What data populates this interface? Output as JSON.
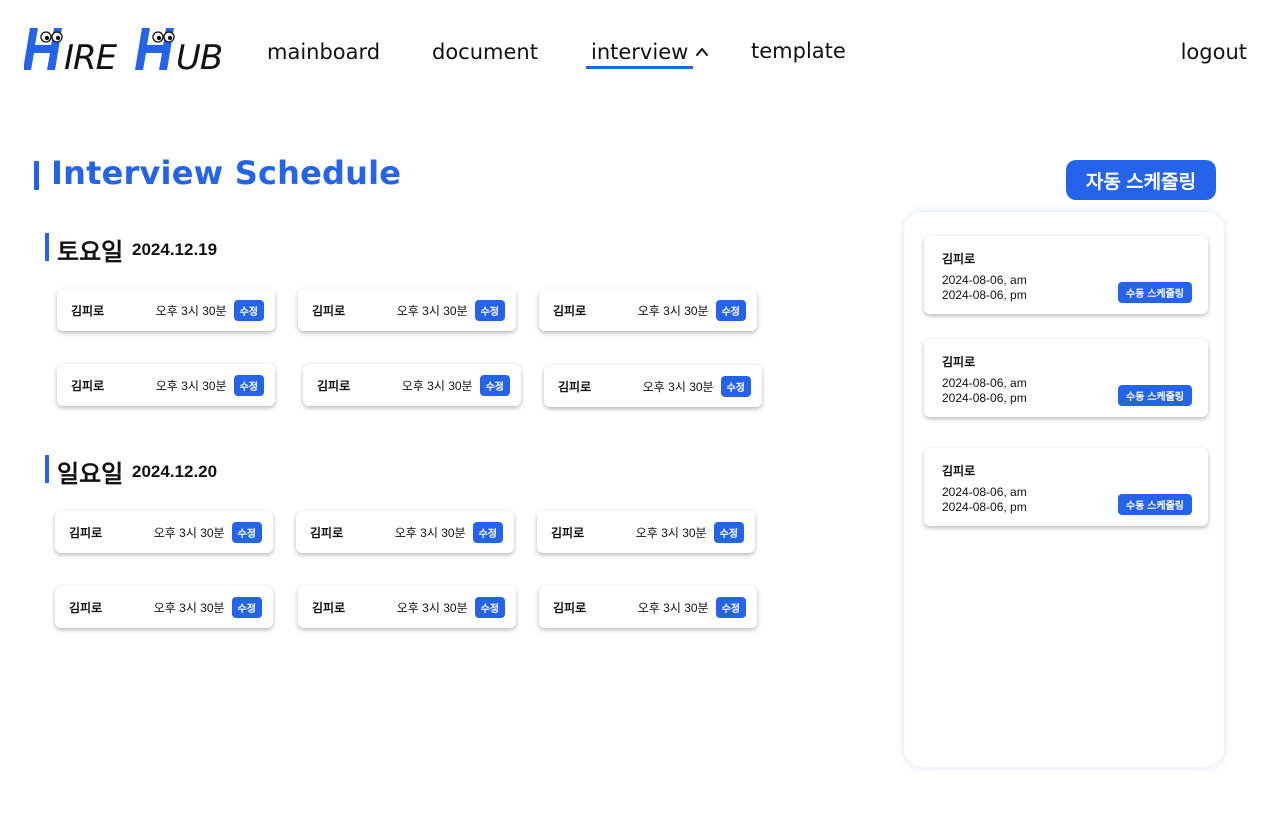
{
  "brand": {
    "logo_text": "HIRE HUB",
    "accent_color": "#2563eb"
  },
  "nav": {
    "items": [
      {
        "label": "mainboard"
      },
      {
        "label": "document"
      },
      {
        "label": "interview",
        "active": true
      },
      {
        "label": "template"
      }
    ],
    "logout_label": "logout"
  },
  "page": {
    "title": "Interview Schedule",
    "auto_schedule_label": "자동 스케줄링"
  },
  "days": [
    {
      "name": "토요일",
      "date": "2024.12.19",
      "slots": [
        {
          "name": "김피로",
          "time": "오후 3시 30분",
          "edit": "수정"
        },
        {
          "name": "김피로",
          "time": "오후 3시 30분",
          "edit": "수정"
        },
        {
          "name": "김피로",
          "time": "오후 3시 30분",
          "edit": "수정"
        },
        {
          "name": "김피로",
          "time": "오후 3시 30분",
          "edit": "수정"
        },
        {
          "name": "김피로",
          "time": "오후 3시 30분",
          "edit": "수정"
        },
        {
          "name": "김피로",
          "time": "오후 3시 30분",
          "edit": "수정"
        }
      ]
    },
    {
      "name": "일요일",
      "date": "2024.12.20",
      "slots": [
        {
          "name": "김피로",
          "time": "오후 3시 30분",
          "edit": "수정"
        },
        {
          "name": "김피로",
          "time": "오후 3시 30분",
          "edit": "수정"
        },
        {
          "name": "김피로",
          "time": "오후 3시 30분",
          "edit": "수정"
        },
        {
          "name": "김피로",
          "time": "오후 3시 30분",
          "edit": "수정"
        },
        {
          "name": "김피로",
          "time": "오후 3시 30분",
          "edit": "수정"
        },
        {
          "name": "김피로",
          "time": "오후 3시 30분",
          "edit": "수정"
        }
      ]
    }
  ],
  "unscheduled": [
    {
      "name": "김피로",
      "line1": "2024-08-06, am",
      "line2": "2024-08-06, pm",
      "button": "수동 스케줄링"
    },
    {
      "name": "김피로",
      "line1": "2024-08-06, am",
      "line2": "2024-08-06, pm",
      "button": "수동 스케줄링"
    },
    {
      "name": "김피로",
      "line1": "2024-08-06, am",
      "line2": "2024-08-06, pm",
      "button": "수동 스케줄링"
    }
  ]
}
